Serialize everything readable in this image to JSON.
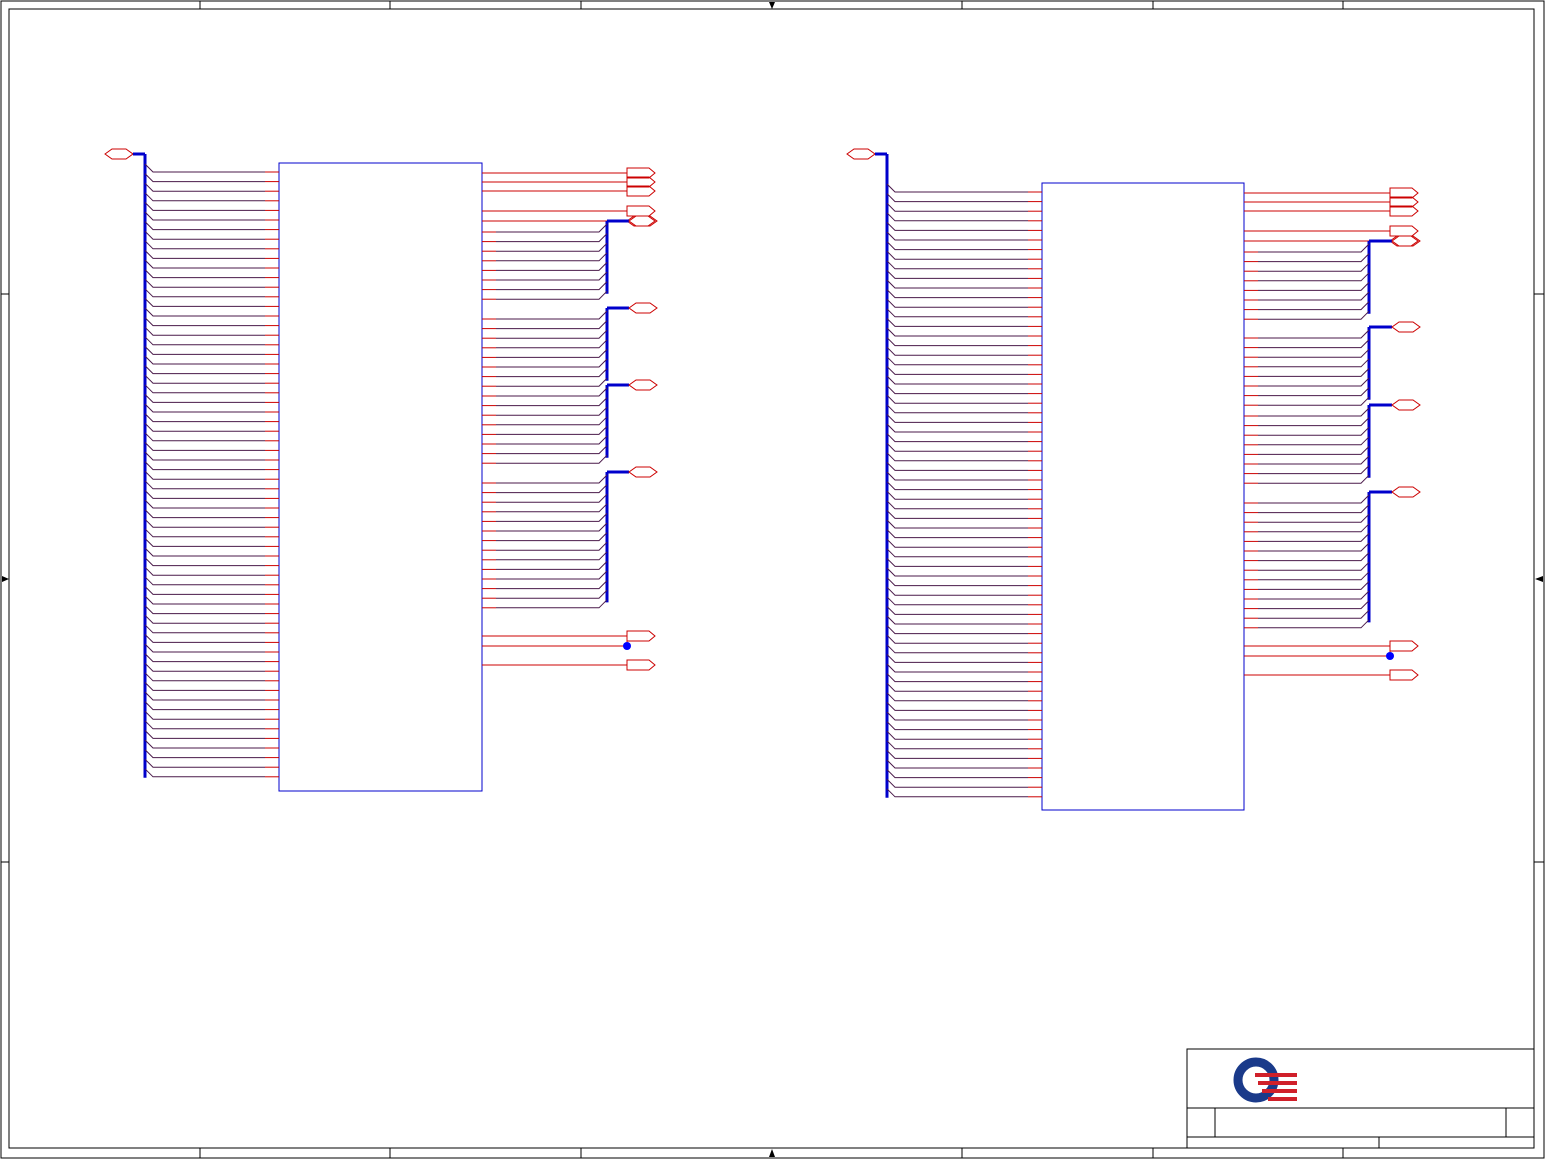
{
  "sheet": {
    "background": "#ffffff",
    "border_color": "#000000",
    "wire_color": "#cc0000",
    "pin_wire_color": "#4a1a4a",
    "bus_color": "#0000cc",
    "component_outline_color": "#0000cc",
    "port_color": "#cc0000",
    "junction_color": "#0000ff"
  },
  "title_block": {
    "logo": {
      "name": "company-logo",
      "ring_color": "#1a3a8a",
      "stripe_color": "#d0202a"
    },
    "title": "",
    "doc_number": "",
    "rev": "",
    "sheet_info": ""
  },
  "schematic": {
    "blocks": [
      {
        "name": "memory-device-left",
        "left_pin_count": 64,
        "bus_groups": 4
      },
      {
        "name": "memory-device-right",
        "left_pin_count": 64,
        "bus_groups": 4
      }
    ]
  }
}
